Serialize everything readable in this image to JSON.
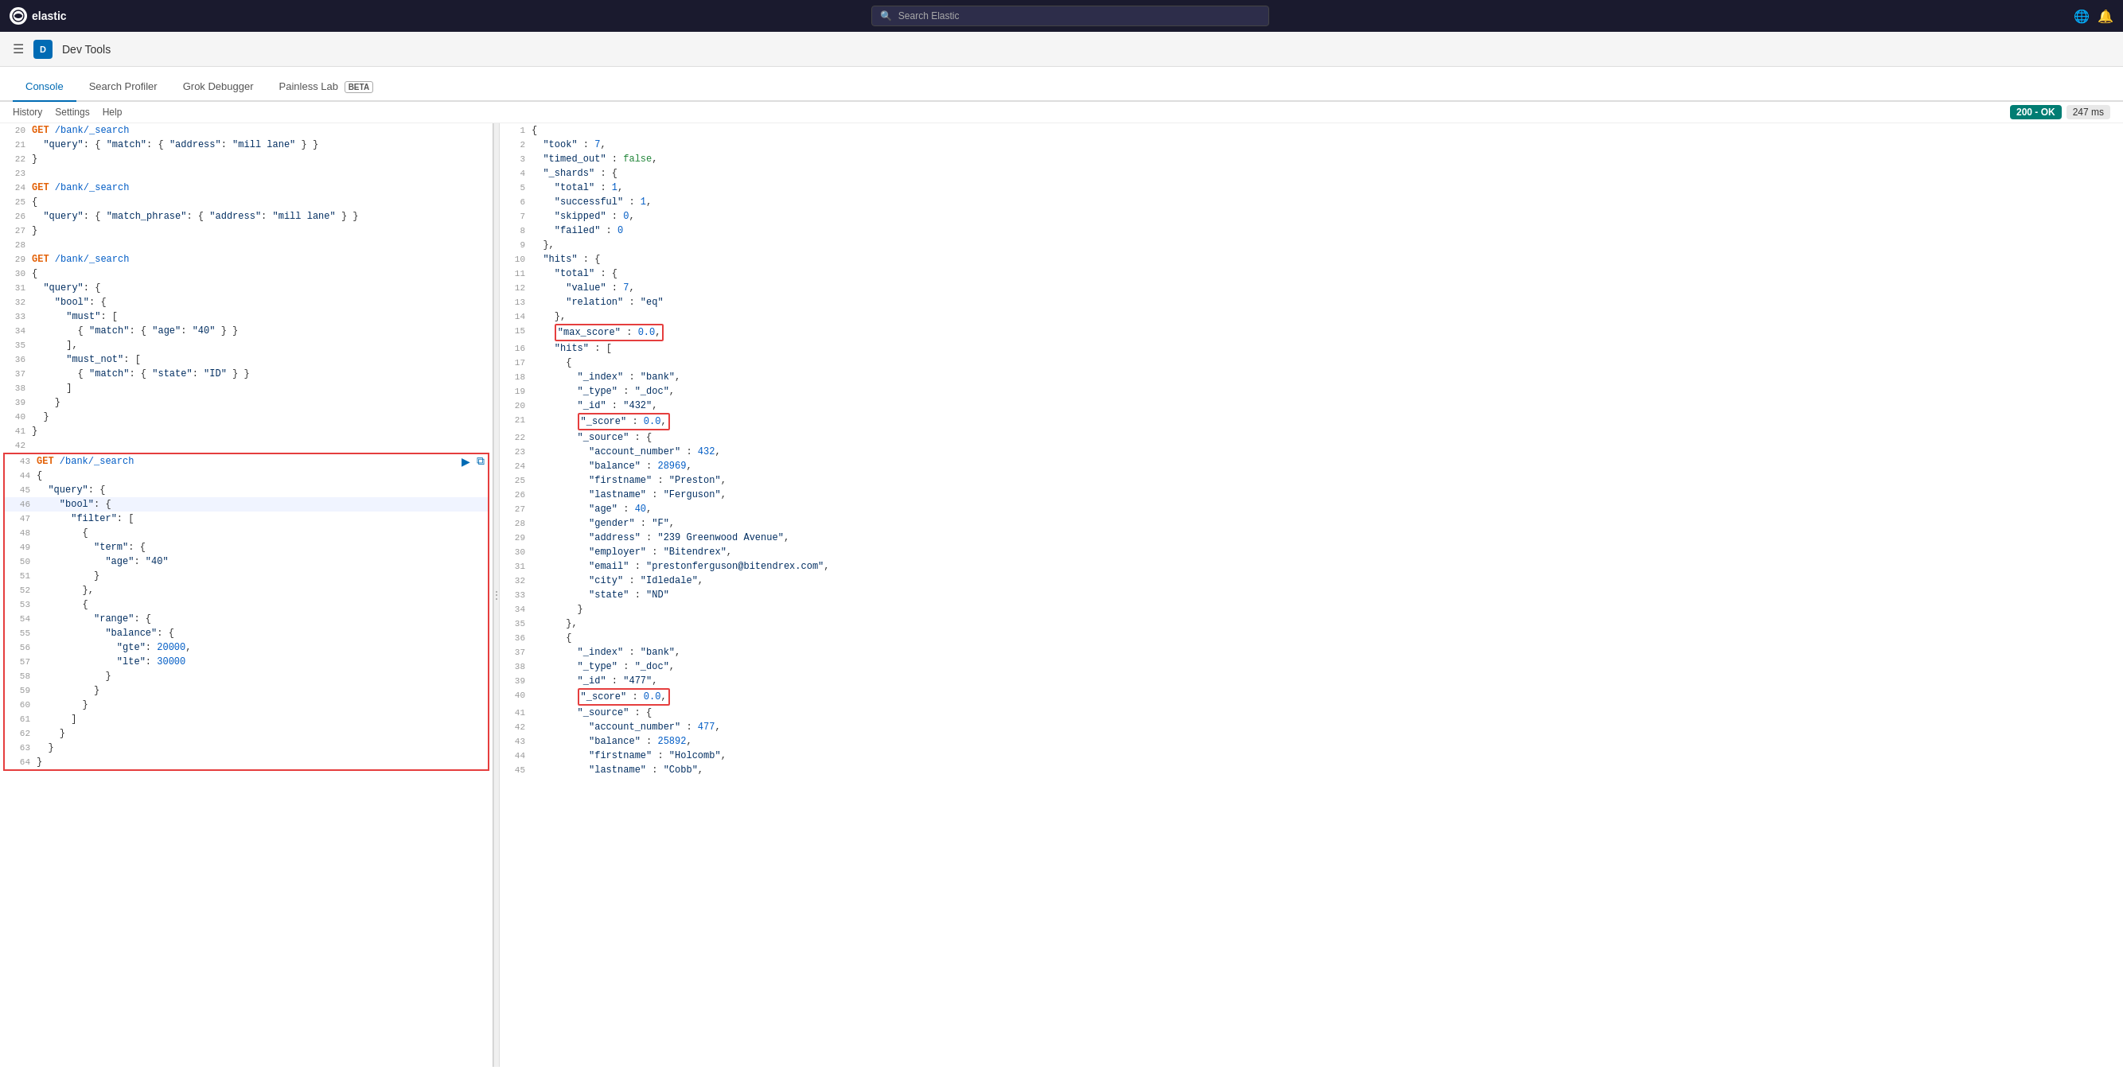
{
  "topBar": {
    "logoText": "elastic",
    "searchPlaceholder": "Search Elastic",
    "globeIcon": "🌐",
    "bellIcon": "🔔"
  },
  "devToolsBar": {
    "appIconLabel": "D",
    "title": "Dev Tools",
    "hamburgerIcon": "☰"
  },
  "tabs": [
    {
      "id": "console",
      "label": "Console",
      "active": true
    },
    {
      "id": "search-profiler",
      "label": "Search Profiler",
      "active": false
    },
    {
      "id": "grok-debugger",
      "label": "Grok Debugger",
      "active": false
    },
    {
      "id": "painless-lab",
      "label": "Painless Lab",
      "active": false,
      "beta": true
    }
  ],
  "secondaryBar": {
    "links": [
      "History",
      "Settings",
      "Help"
    ],
    "statusCode": "200 - OK",
    "responseTime": "247 ms"
  },
  "editor": {
    "lines": [
      {
        "num": "20",
        "content": "  GET /bank/_search",
        "type": "comment"
      },
      {
        "num": "21",
        "content": "  \"query\": { \"match\": { \"address\": \"mill lane\" } }"
      },
      {
        "num": "22",
        "content": "}"
      },
      {
        "num": "23",
        "content": ""
      },
      {
        "num": "24",
        "content": "GET /bank/_search",
        "type": "get"
      },
      {
        "num": "25",
        "content": "{"
      },
      {
        "num": "26",
        "content": "  \"query\": { \"match_phrase\": { \"address\": \"mill lane\" } }"
      },
      {
        "num": "27",
        "content": "}"
      },
      {
        "num": "28",
        "content": ""
      },
      {
        "num": "29",
        "content": "GET /bank/_search",
        "type": "get"
      },
      {
        "num": "30",
        "content": "{"
      },
      {
        "num": "31",
        "content": "  \"query\": {"
      },
      {
        "num": "32",
        "content": "    \"bool\": {"
      },
      {
        "num": "33",
        "content": "      \"must\": ["
      },
      {
        "num": "34",
        "content": "        { \"match\": { \"age\": \"40\" } }"
      },
      {
        "num": "35",
        "content": "      ],"
      },
      {
        "num": "36",
        "content": "      \"must_not\": ["
      },
      {
        "num": "37",
        "content": "        { \"match\": { \"state\": \"ID\" } }"
      },
      {
        "num": "38",
        "content": "      ]"
      },
      {
        "num": "39",
        "content": "    }"
      },
      {
        "num": "40",
        "content": "  }"
      },
      {
        "num": "41",
        "content": "}"
      },
      {
        "num": "42",
        "content": ""
      },
      {
        "num": "43",
        "content": "GET /bank/_search",
        "type": "get",
        "selected": true
      },
      {
        "num": "44",
        "content": "{",
        "selected": true
      },
      {
        "num": "45",
        "content": "  \"query\": {",
        "selected": true
      },
      {
        "num": "46",
        "content": "    \"bool\": {",
        "selected": true,
        "highlighted": true
      },
      {
        "num": "47",
        "content": "      \"filter\": [",
        "selected": true
      },
      {
        "num": "48",
        "content": "        {",
        "selected": true
      },
      {
        "num": "49",
        "content": "          \"term\": {",
        "selected": true
      },
      {
        "num": "50",
        "content": "            \"age\": \"40\"",
        "selected": true
      },
      {
        "num": "51",
        "content": "          }",
        "selected": true
      },
      {
        "num": "52",
        "content": "        },",
        "selected": true
      },
      {
        "num": "53",
        "content": "        {",
        "selected": true
      },
      {
        "num": "54",
        "content": "          \"range\": {",
        "selected": true
      },
      {
        "num": "55",
        "content": "            \"balance\": {",
        "selected": true
      },
      {
        "num": "56",
        "content": "              \"gte\": 20000,",
        "selected": true
      },
      {
        "num": "57",
        "content": "              \"lte\": 30000",
        "selected": true
      },
      {
        "num": "58",
        "content": "            }",
        "selected": true
      },
      {
        "num": "59",
        "content": "          }",
        "selected": true
      },
      {
        "num": "60",
        "content": "        }",
        "selected": true
      },
      {
        "num": "61",
        "content": "      ]",
        "selected": true
      },
      {
        "num": "62",
        "content": "    }",
        "selected": true
      },
      {
        "num": "63",
        "content": "  }",
        "selected": true
      },
      {
        "num": "64",
        "content": "}",
        "selected": true
      }
    ]
  },
  "output": {
    "lines": [
      {
        "num": "1",
        "content": "{"
      },
      {
        "num": "2",
        "content": "  \"took\" : 7,"
      },
      {
        "num": "3",
        "content": "  \"timed_out\" : false,"
      },
      {
        "num": "4",
        "content": "  \"_shards\" : {"
      },
      {
        "num": "5",
        "content": "    \"total\" : 1,"
      },
      {
        "num": "6",
        "content": "    \"successful\" : 1,"
      },
      {
        "num": "7",
        "content": "    \"skipped\" : 0,"
      },
      {
        "num": "8",
        "content": "    \"failed\" : 0"
      },
      {
        "num": "9",
        "content": "  },"
      },
      {
        "num": "10",
        "content": "  \"hits\" : {"
      },
      {
        "num": "11",
        "content": "    \"total\" : {"
      },
      {
        "num": "12",
        "content": "      \"value\" : 7,"
      },
      {
        "num": "13",
        "content": "      \"relation\" : \"eq\""
      },
      {
        "num": "14",
        "content": "    },"
      },
      {
        "num": "15",
        "content": "    \"max_score\" : 0.0,",
        "highlighted": true
      },
      {
        "num": "16",
        "content": "    \"hits\" : ["
      },
      {
        "num": "17",
        "content": "      {"
      },
      {
        "num": "18",
        "content": "        \"_index\" : \"bank\","
      },
      {
        "num": "19",
        "content": "        \"_type\" : \"_doc\","
      },
      {
        "num": "20",
        "content": "        \"_id\" : \"432\","
      },
      {
        "num": "21",
        "content": "        \"_score\" : 0.0,",
        "highlighted": true
      },
      {
        "num": "22",
        "content": "        \"_source\" : {"
      },
      {
        "num": "23",
        "content": "          \"account_number\" : 432,"
      },
      {
        "num": "24",
        "content": "          \"balance\" : 28969,"
      },
      {
        "num": "25",
        "content": "          \"firstname\" : \"Preston\","
      },
      {
        "num": "26",
        "content": "          \"lastname\" : \"Ferguson\","
      },
      {
        "num": "27",
        "content": "          \"age\" : 40,"
      },
      {
        "num": "28",
        "content": "          \"gender\" : \"F\","
      },
      {
        "num": "29",
        "content": "          \"address\" : \"239 Greenwood Avenue\","
      },
      {
        "num": "30",
        "content": "          \"employer\" : \"Bitendrex\","
      },
      {
        "num": "31",
        "content": "          \"email\" : \"prestonferguson@bitendrex.com\","
      },
      {
        "num": "32",
        "content": "          \"city\" : \"Idledale\","
      },
      {
        "num": "33",
        "content": "          \"state\" : \"ND\""
      },
      {
        "num": "34",
        "content": "        }"
      },
      {
        "num": "35",
        "content": "      },"
      },
      {
        "num": "36",
        "content": "      {"
      },
      {
        "num": "37",
        "content": "        \"_index\" : \"bank\","
      },
      {
        "num": "38",
        "content": "        \"_type\" : \"_doc\","
      },
      {
        "num": "39",
        "content": "        \"_id\" : \"477\","
      },
      {
        "num": "40",
        "content": "        \"_score\" : 0.0,",
        "highlighted": true
      },
      {
        "num": "41",
        "content": "        \"_source\" : {"
      },
      {
        "num": "42",
        "content": "          \"account_number\" : 477,"
      },
      {
        "num": "43",
        "content": "          \"balance\" : 25892,"
      },
      {
        "num": "44",
        "content": "          \"firstname\" : \"Holcomb\","
      },
      {
        "num": "45",
        "content": "          \"lastname\" : \"Cobb\","
      }
    ]
  }
}
